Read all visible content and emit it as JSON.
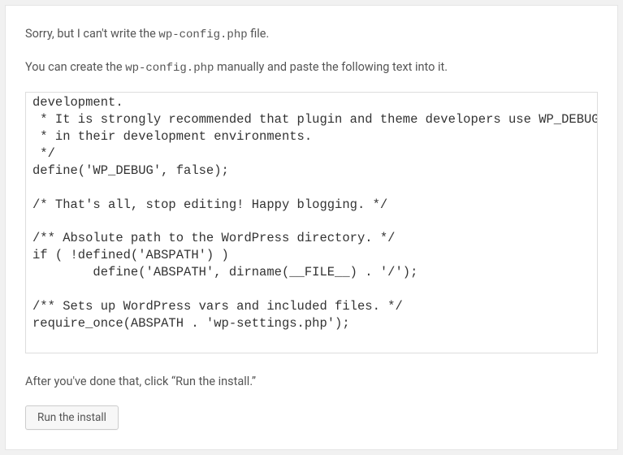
{
  "message1_a": "Sorry, but I can't write the ",
  "message1_code": "wp-config.php",
  "message1_b": " file.",
  "message2_a": "You can create the ",
  "message2_code": "wp-config.php",
  "message2_b": " manually and paste the following text into it.",
  "code_content": "development.\n * It is strongly recommended that plugin and theme developers use WP_DEBUG\n * in their development environments.\n */\ndefine('WP_DEBUG', false);\n\n/* That's all, stop editing! Happy blogging. */\n\n/** Absolute path to the WordPress directory. */\nif ( !defined('ABSPATH') )\n        define('ABSPATH', dirname(__FILE__) . '/');\n\n/** Sets up WordPress vars and included files. */\nrequire_once(ABSPATH . 'wp-settings.php');\n",
  "message3": "After you've done that, click “Run the install.”",
  "button_label": "Run the install"
}
